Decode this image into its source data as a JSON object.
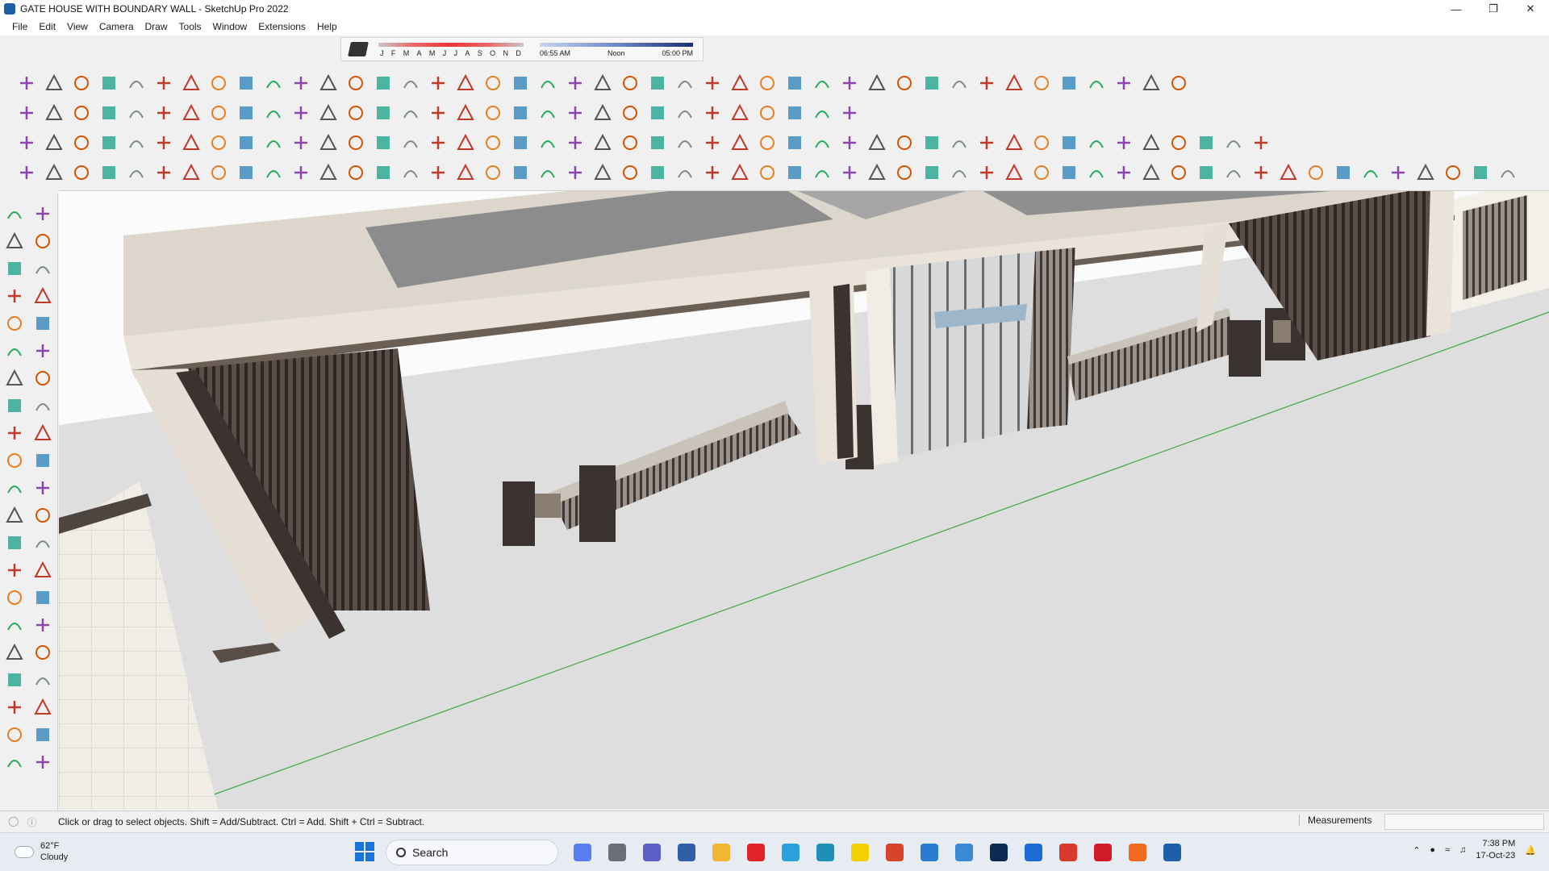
{
  "window": {
    "title": "GATE HOUSE WITH BOUNDARY WALL - SketchUp Pro 2022",
    "minimize_icon": "minimize-icon",
    "maximize_icon": "restore-icon",
    "close_icon": "close-icon"
  },
  "menu": {
    "items": [
      "File",
      "Edit",
      "View",
      "Camera",
      "Draw",
      "Tools",
      "Window",
      "Extensions",
      "Help"
    ]
  },
  "shadow_settings": {
    "months": [
      "J",
      "F",
      "M",
      "A",
      "M",
      "J",
      "J",
      "A",
      "S",
      "O",
      "N",
      "D"
    ],
    "time_start": "06:55 AM",
    "time_mid": "Noon",
    "time_end": "05:00 PM"
  },
  "toolbar_icons": {
    "row1": [
      "draw-tool-icon",
      "curve-icon",
      "eraser-curve-icon",
      "scissors-icon",
      "polygon-icon",
      "cloud-icon",
      "hook-icon",
      "glasses-icon",
      "ring-icon",
      "arrow-curve-icon",
      "corner-icon",
      "bend-icon",
      "line-icon",
      "pipe-icon",
      "frame-icon",
      "lamp-icon",
      "columns-icon",
      "rails-icon",
      "grille-icon",
      "arch-icon",
      "leaf-icon",
      "fold-icon",
      "layers-icon",
      "slope-icon",
      "fence-icon",
      "brush-icon",
      "stairs-icon",
      "hatch-icon",
      "roof-icon",
      "door-icon",
      "wall-icon",
      "grid-icon",
      "pattern-icon",
      "fan-icon",
      "gear-icon",
      "stripe-icon",
      "truss-icon",
      "bench-icon",
      "box-icon",
      "home-icon",
      "house-front-icon",
      "house-outline-icon",
      "garage-icon"
    ],
    "row2": [
      "zoom-icon",
      "select-arrow-icon",
      "eraser-icon",
      "pencil-icon",
      "arc-icon",
      "rectangle-icon",
      "push-pull-icon",
      "follow-me-icon",
      "move-icon",
      "rotate-icon",
      "scale-icon",
      "tape-icon",
      "text-icon",
      "paint-icon",
      "orbit-icon",
      "pan-icon",
      "zoom-window-icon",
      "zoom-extents-icon",
      "section-icon",
      "section-display-icon",
      "layers-stack-icon",
      "style-icon",
      "user-icon",
      "shape-icon",
      "cube-red-icon",
      "blue-shape-icon",
      "red-shape-icon",
      "green-shape-icon",
      "orange-shape-icon",
      "purple-shape-icon",
      "pointer-tool-icon"
    ],
    "row3": [
      "camera-icon",
      "cube-icon",
      "cube2-icon",
      "grass-icon",
      "hatch2-icon",
      "grid2-icon",
      "frame2-icon",
      "frame3-icon",
      "speech-icon",
      "knife-icon",
      "rect-plus-icon",
      "circle-icon",
      "ellipse-icon",
      "ellipse2-icon",
      "parallelogram-icon",
      "tube-icon",
      "link-icon",
      "ribbon-icon",
      "chain-icon",
      "hook2-icon",
      "measure-icon",
      "lamp2-icon",
      "section-plane-icon",
      "section-cut-icon",
      "section-fill-icon",
      "section-blue-icon",
      "book-icon",
      "tree-icon",
      "dial-icon",
      "dial2-icon",
      "hand-icon",
      "hand2-icon",
      "spiral-icon",
      "refresh-icon",
      "ruler-icon",
      "panel-icon",
      "panel2-icon",
      "panel3-icon",
      "panel4-icon",
      "brick-icon",
      "brick2-icon",
      "material-icon",
      "material2-icon",
      "material3-icon",
      "material4-icon",
      "material5-icon"
    ],
    "row4": [
      "settings-red-icon",
      "cup-icon",
      "target-icon",
      "cone-icon",
      "stool-icon",
      "star-icon",
      "bowl-icon",
      "sphere-icon",
      "solid-union-icon",
      "solid-subtract-icon",
      "hatch-box-icon",
      "iso-box-icon",
      "iso-box2-icon",
      "sphere-grid-icon",
      "ball-icon",
      "touch-icon",
      "blue-face-icon",
      "blue-face2-icon",
      "gold-face-icon",
      "green-face-icon",
      "red-face-icon",
      "white-face-icon",
      "curl-icon",
      "red-box-icon",
      "panel-red-icon",
      "flag-icon",
      "box-brown-icon",
      "chain2-icon",
      "hook3-icon",
      "dots-curve-icon",
      "red-cross-icon",
      "green-cross-icon",
      "blue-x-icon",
      "cone-cyan-icon",
      "cone-teal-icon",
      "triangle-icon",
      "horseshoe-icon",
      "horseshoe2-icon",
      "circle-arrows-icon",
      "move-arrows-icon",
      "bucket-icon",
      "magnet-icon",
      "tree-green-icon",
      "tools-icon",
      "boxes-icon",
      "boxes2-icon",
      "cube-yellow-icon",
      "grid3-icon",
      "frame-blue-icon",
      "gold-tile-icon",
      "gold-tile2-icon",
      "gold-tile3-icon",
      "red-x-icon",
      "bezier-icon",
      "nodes-icon"
    ]
  },
  "palette_icons": [
    "select-icon",
    "orbit-palette-icon",
    "paint-bucket-icon",
    "eraser-palette-icon",
    "component-icon",
    "tag-icon",
    "line-palette-icon",
    "freehand-icon",
    "rectangle-palette-icon",
    "rotated-rect-icon",
    "circle-palette-icon",
    "polygon-palette-icon",
    "arc-palette-icon",
    "arc2-icon",
    "arc3-icon",
    "pie-icon",
    "move-palette-icon",
    "push-pull-palette-icon",
    "rotate-palette-icon",
    "follow-me-palette-icon",
    "scale-palette-icon",
    "offset-icon",
    "tape-palette-icon",
    "dimension-icon",
    "protractor-icon",
    "text-palette-icon",
    "axes-icon",
    "3d-text-icon",
    "orbit2-icon",
    "pan-palette-icon",
    "zoom-palette-icon",
    "zoom-window-palette-icon",
    "zoom-extents-palette-icon",
    "previous-view-icon",
    "position-camera-icon",
    "look-around-icon",
    "walk-icon",
    "section-plane-palette-icon",
    "sandbox-icon",
    "sandbox2-icon",
    "sandbox3-icon",
    "sandbox4-icon"
  ],
  "status": {
    "info_icons": [
      "geo-icon",
      "info-icon"
    ],
    "hint": "Click or drag to select objects. Shift = Add/Subtract. Ctrl = Add. Shift + Ctrl = Subtract.",
    "measurements_label": "Measurements",
    "measurements_value": ""
  },
  "taskbar": {
    "temperature": "62°F",
    "weather": "Cloudy",
    "search_placeholder": "Search",
    "apps": [
      {
        "name": "copilot-icon",
        "color": "#5a7ef0"
      },
      {
        "name": "task-view-icon",
        "color": "#6b6f77"
      },
      {
        "name": "teams-icon",
        "color": "#5b5fc7"
      },
      {
        "name": "calculator-icon",
        "color": "#2f5fa8"
      },
      {
        "name": "file-explorer-icon",
        "color": "#f2b632"
      },
      {
        "name": "opera-icon",
        "color": "#e0222b"
      },
      {
        "name": "telegram-icon",
        "color": "#2aa1da"
      },
      {
        "name": "app-blue-icon",
        "color": "#1d8fb8"
      },
      {
        "name": "sticky-notes-icon",
        "color": "#f5d000"
      },
      {
        "name": "grammarly-icon",
        "color": "#d8442a"
      },
      {
        "name": "vscode-icon",
        "color": "#2b7bd1"
      },
      {
        "name": "app-3-icon",
        "color": "#3a8ad6"
      },
      {
        "name": "photoshop-icon",
        "color": "#0d2a55"
      },
      {
        "name": "drive-icon",
        "color": "#1e6bd4"
      },
      {
        "name": "chrome-icon",
        "color": "#d93a2a"
      },
      {
        "name": "pinterest-icon",
        "color": "#d21b2a"
      },
      {
        "name": "soundcloud-icon",
        "color": "#f26b1d"
      },
      {
        "name": "sketchup-taskbar-icon",
        "color": "#1f5fa8"
      }
    ],
    "time": "7:38 PM",
    "date": "17-Oct-23"
  }
}
